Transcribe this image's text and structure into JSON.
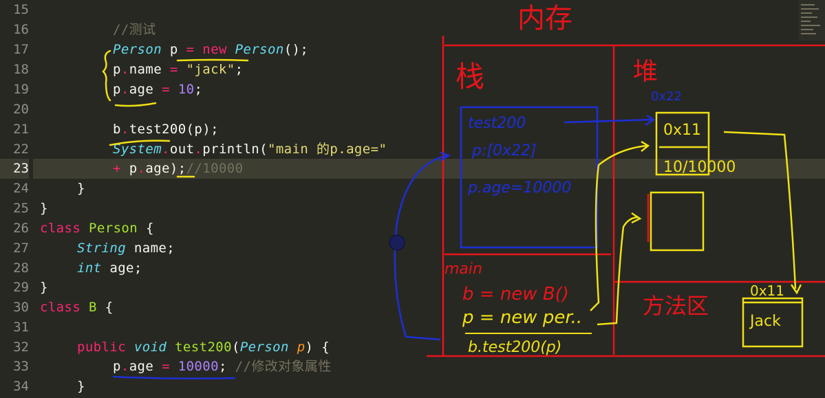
{
  "editor": {
    "active_line": "23",
    "lines": [
      {
        "n": "15"
      },
      {
        "n": "16",
        "comment": "//测试"
      },
      {
        "n": "17",
        "type": "Person",
        "var": "p",
        "op": "=",
        "kw_new": "new",
        "ctor": "Person",
        "tail": "();"
      },
      {
        "n": "18",
        "obj": "p",
        "field": "name",
        "op": "=",
        "str": "\"jack\"",
        "tail": ";"
      },
      {
        "n": "19",
        "obj": "p",
        "field": "age",
        "op": "=",
        "num": "10",
        "tail": ";"
      },
      {
        "n": "20"
      },
      {
        "n": "21",
        "obj": "b",
        "call": "test200(p);"
      },
      {
        "n": "22",
        "sys": "System",
        "out": "out",
        "method": "println(",
        "str": "\"main 的p.age=\""
      },
      {
        "n": "23",
        "plus": "+",
        "obj": "p",
        "field": "age",
        "tail": ");",
        "comment": "//10000"
      },
      {
        "n": "24",
        "brace": "}"
      },
      {
        "n": "25",
        "brace": "}"
      },
      {
        "n": "26",
        "kw": "class",
        "cls": "Person",
        "brace": "{"
      },
      {
        "n": "27",
        "type": "String",
        "field": "name;"
      },
      {
        "n": "28",
        "type": "int",
        "field": "age;"
      },
      {
        "n": "29",
        "brace": "}"
      },
      {
        "n": "30",
        "kw": "class",
        "cls": "B",
        "brace": "{"
      },
      {
        "n": "31"
      },
      {
        "n": "32",
        "kw": "public",
        "type": "void",
        "fn": "test200",
        "paren": "(",
        "ptype": "Person",
        "pname": "p",
        "tail": ") {"
      },
      {
        "n": "33",
        "obj": "p",
        "field": "age",
        "op": "=",
        "num": "10000",
        "tail": ";",
        "comment": "//修改对象属性"
      },
      {
        "n": "34",
        "brace": "}"
      }
    ]
  },
  "annotations": {
    "memory_label": "内存",
    "stack_label": "栈",
    "heap_label": "堆",
    "method_area_label": "方法区",
    "main_frame_label": "main",
    "test200_frame_label": "test200",
    "test200_param": "p:[0x22]",
    "test200_stmt": "p.age=10000",
    "main_stmt_1": "b = new B()",
    "main_stmt_2": "p = new per..",
    "main_stmt_3": "b.test200(p)",
    "heap_addr_1": "0x22",
    "heap_obj1_field1": "0x11",
    "heap_obj1_field2": "10/10000",
    "method_area_addr": "0x11",
    "method_area_value": "Jack",
    "colors": {
      "red": "#e8141a",
      "yellow": "#f0e016",
      "blue": "#1d2fd6",
      "green": "#2bd62b"
    }
  }
}
